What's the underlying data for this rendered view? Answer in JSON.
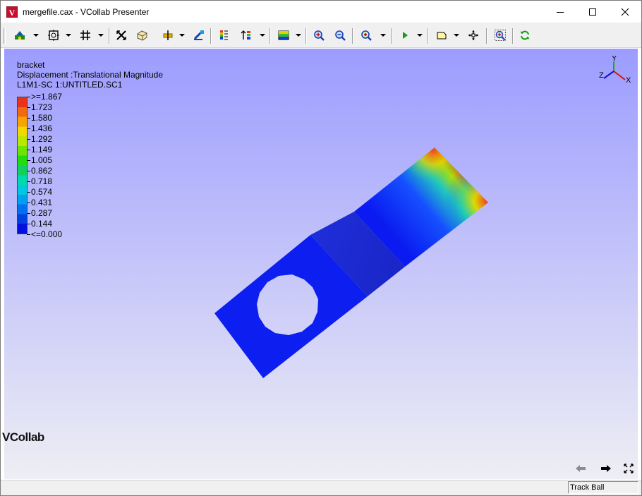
{
  "window": {
    "title": "mergefile.cax - VCollab Presenter",
    "app_icon_letter": "V"
  },
  "toolbar": {
    "buttons": [
      "display-mode-icon",
      "fit-view-icon",
      "grid-icon",
      "explode-icon",
      "box-view-icon",
      "transform-icon",
      "probe-icon",
      "legend-icon",
      "sort-icon",
      "contour-icon",
      "zoom-in-icon",
      "zoom-out-icon",
      "zoom-box-icon",
      "play-icon",
      "note-icon",
      "pan-icon",
      "zoom-fit-icon",
      "refresh-icon"
    ]
  },
  "viewport": {
    "model_name": "bracket",
    "result_name": "Displacement :Translational Magnitude",
    "case_name": "L1M1-SC 1:UNTITLED.SC1",
    "background_top": "#9c9cff",
    "background_bottom": "#eeeef4"
  },
  "legend": {
    "labels": [
      ">=1.867",
      "1.723",
      "1.580",
      "1.436",
      "1.292",
      "1.149",
      "1.005",
      "0.862",
      "0.718",
      "0.574",
      "0.431",
      "0.287",
      "0.144",
      "<=0.000"
    ],
    "colors": [
      "#e8321a",
      "#f06a10",
      "#f7a300",
      "#f2d800",
      "#b9e800",
      "#6fe400",
      "#22dc10",
      "#10d064",
      "#00d8b0",
      "#00c8e0",
      "#00a0f0",
      "#0070f0",
      "#0040e0",
      "#0010e0"
    ]
  },
  "triad": {
    "x_label": "X",
    "y_label": "Y",
    "z_label": "Z"
  },
  "nav": {
    "back_icon": "arrow-left-icon",
    "forward_icon": "arrow-right-icon",
    "fullscreen_icon": "fullscreen-icon"
  },
  "brand": {
    "logo_text": "VCollab"
  },
  "status": {
    "mode": "Track Ball"
  }
}
